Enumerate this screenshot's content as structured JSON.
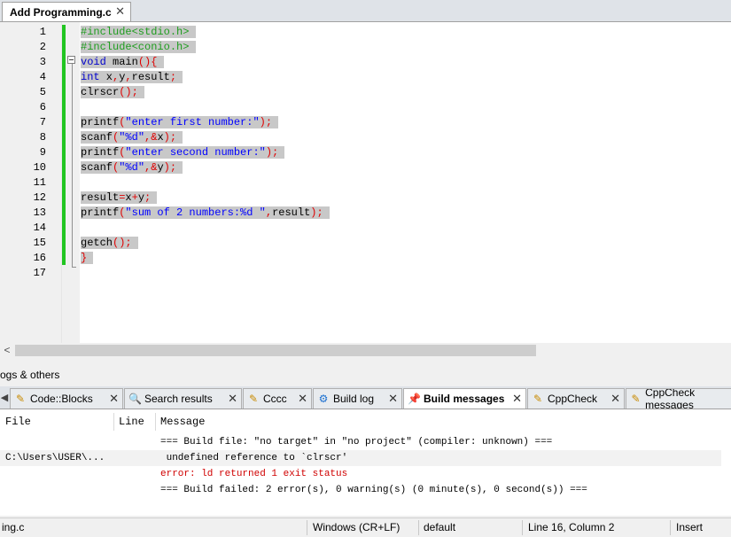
{
  "editor": {
    "tab_label": "Add Programming.c",
    "close_glyph": "✕",
    "line_numbers": [
      "1",
      "2",
      "3",
      "4",
      "5",
      "6",
      "7",
      "8",
      "9",
      "10",
      "11",
      "12",
      "13",
      "14",
      "15",
      "16",
      "17"
    ],
    "lines": [
      [
        {
          "t": "#include<stdio.h>",
          "c": "pp"
        }
      ],
      [
        {
          "t": "#include<conio.h>",
          "c": "pp"
        }
      ],
      [
        {
          "t": "void",
          "c": "kw"
        },
        {
          "t": " main",
          "c": "id"
        },
        {
          "t": "(){",
          "c": "op"
        }
      ],
      [
        {
          "t": "int",
          "c": "kw"
        },
        {
          "t": " x",
          "c": "id"
        },
        {
          "t": ",",
          "c": "op"
        },
        {
          "t": "y",
          "c": "id"
        },
        {
          "t": ",",
          "c": "op"
        },
        {
          "t": "result",
          "c": "id"
        },
        {
          "t": ";",
          "c": "op"
        }
      ],
      [
        {
          "t": "clrscr",
          "c": "id"
        },
        {
          "t": "();",
          "c": "op"
        }
      ],
      [],
      [
        {
          "t": "printf",
          "c": "id"
        },
        {
          "t": "(",
          "c": "op"
        },
        {
          "t": "\"enter first number:\"",
          "c": "str"
        },
        {
          "t": ");",
          "c": "op"
        }
      ],
      [
        {
          "t": "scanf",
          "c": "id"
        },
        {
          "t": "(",
          "c": "op"
        },
        {
          "t": "\"%d\"",
          "c": "str"
        },
        {
          "t": ",&",
          "c": "op"
        },
        {
          "t": "x",
          "c": "id"
        },
        {
          "t": ");",
          "c": "op"
        }
      ],
      [
        {
          "t": "printf",
          "c": "id"
        },
        {
          "t": "(",
          "c": "op"
        },
        {
          "t": "\"enter second number:\"",
          "c": "str"
        },
        {
          "t": ");",
          "c": "op"
        }
      ],
      [
        {
          "t": "scanf",
          "c": "id"
        },
        {
          "t": "(",
          "c": "op"
        },
        {
          "t": "\"%d\"",
          "c": "str"
        },
        {
          "t": ",&",
          "c": "op"
        },
        {
          "t": "y",
          "c": "id"
        },
        {
          "t": ");",
          "c": "op"
        }
      ],
      [],
      [
        {
          "t": "result",
          "c": "id"
        },
        {
          "t": "=",
          "c": "op"
        },
        {
          "t": "x",
          "c": "id"
        },
        {
          "t": "+",
          "c": "op"
        },
        {
          "t": "y",
          "c": "id"
        },
        {
          "t": ";",
          "c": "op"
        }
      ],
      [
        {
          "t": "printf",
          "c": "id"
        },
        {
          "t": "(",
          "c": "op"
        },
        {
          "t": "\"sum of 2 numbers:%d \"",
          "c": "str"
        },
        {
          "t": ",",
          "c": "op"
        },
        {
          "t": "result",
          "c": "id"
        },
        {
          "t": ");",
          "c": "op"
        }
      ],
      [],
      [
        {
          "t": "getch",
          "c": "id"
        },
        {
          "t": "();",
          "c": "op"
        }
      ],
      [
        {
          "t": "}",
          "c": "op"
        }
      ],
      []
    ]
  },
  "logs": {
    "panel_title": "ogs & others",
    "scroll_left_glyph": "◀",
    "tabs": [
      {
        "label": "Code::Blocks",
        "icon": "✎",
        "icon_name": "document-pencil-icon",
        "active": false
      },
      {
        "label": "Search results",
        "icon": "🔍",
        "icon_name": "search-icon",
        "active": false
      },
      {
        "label": "Cccc",
        "icon": "✎",
        "icon_name": "document-pencil-icon",
        "active": false
      },
      {
        "label": "Build log",
        "icon": "⚙",
        "icon_name": "build-gear-icon",
        "active": false
      },
      {
        "label": "Build messages",
        "icon": "📌",
        "icon_name": "pushpin-icon",
        "active": true
      },
      {
        "label": "CppCheck",
        "icon": "✎",
        "icon_name": "document-pencil-icon",
        "active": false
      },
      {
        "label": "CppCheck messages",
        "icon": "✎",
        "icon_name": "document-pencil-icon",
        "active": false
      }
    ],
    "columns": {
      "file": "File",
      "line": "Line",
      "message": "Message"
    },
    "messages": [
      {
        "file": "",
        "line": "",
        "text": "=== Build file: \"no target\" in \"no project\" (compiler: unknown) ===",
        "color": "#000000"
      },
      {
        "file": "C:\\Users\\USER\\...",
        "line": "",
        "text": " undefined reference to `clrscr'",
        "color": "#000000"
      },
      {
        "file": "",
        "line": "",
        "text": "error: ld returned 1 exit status",
        "color": "#d00000"
      },
      {
        "file": "",
        "line": "",
        "text": "=== Build failed: 2 error(s), 0 warning(s) (0 minute(s), 0 second(s)) ===",
        "color": "#000000"
      }
    ]
  },
  "status": {
    "file": "ing.c",
    "line_endings": "Windows (CR+LF)",
    "encoding": "default",
    "position": "Line 16, Column 2",
    "mode": "Insert"
  },
  "colors": {
    "change_bar": "#21c521",
    "selection": "#c8c8c8",
    "preprocessor": "#1f9d1f",
    "keyword": "#0000cc",
    "string": "#0000ff",
    "operator": "#e00000",
    "error": "#d00000"
  }
}
